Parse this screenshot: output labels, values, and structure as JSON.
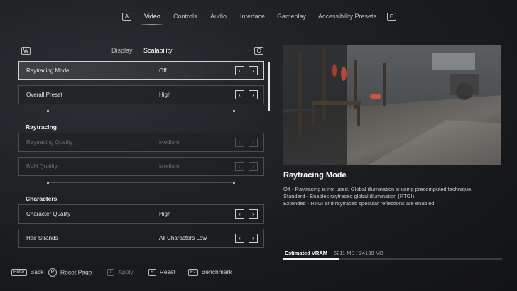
{
  "top_nav": {
    "left_key": "A",
    "right_key": "E",
    "tabs": [
      "Video",
      "Controls",
      "Audio",
      "Interface",
      "Gameplay",
      "Accessibility Presets"
    ],
    "active_tab": "Video"
  },
  "sub_nav": {
    "left_key": "W",
    "right_key": "C",
    "tabs": [
      "Display",
      "Scalability"
    ],
    "active_tab": "Scalability"
  },
  "settings": {
    "rows": [
      {
        "label": "Raytracing Mode",
        "value": "Off",
        "state": "selected"
      },
      {
        "label": "Overall Preset",
        "value": "High",
        "state": "enabled"
      },
      {
        "label": "Raytracing Quality",
        "value": "Medium",
        "state": "disabled"
      },
      {
        "label": "BVH Quality",
        "value": "Medium",
        "state": "disabled"
      },
      {
        "label": "Character Quality",
        "value": "High",
        "state": "enabled"
      },
      {
        "label": "Hair Strands",
        "value": "All Characters Low",
        "state": "enabled"
      }
    ],
    "sections": [
      "Raytracing",
      "Characters"
    ],
    "arrow_left": "‹",
    "arrow_right": "›"
  },
  "detail": {
    "title": "Raytracing Mode",
    "lines": [
      "Off - Raytracing is not used. Global illumination is using precomputed technique.",
      "Standard - Enables raytraced global illumination (RTGI).",
      "Extended - RTGI and raytraced specular reflections are enabled."
    ]
  },
  "vram": {
    "label": "Estimated VRAM",
    "value": "6211 MB / 24138 MB",
    "fraction": 0.257
  },
  "footer": {
    "items": [
      {
        "key": "Enter",
        "label": "Back",
        "disabled": false
      },
      {
        "key": "R",
        "label": "Reset Page",
        "disabled": false
      },
      {
        "key": "X",
        "label": "Apply",
        "disabled": true
      },
      {
        "key": "R",
        "label": "Reset",
        "disabled": false
      },
      {
        "key": "F2",
        "label": "Benchmark",
        "disabled": false
      }
    ]
  },
  "colors": {
    "background": "#1a1c1f",
    "accent": "#ffffff",
    "disabled_text": "#6b6b6b"
  }
}
